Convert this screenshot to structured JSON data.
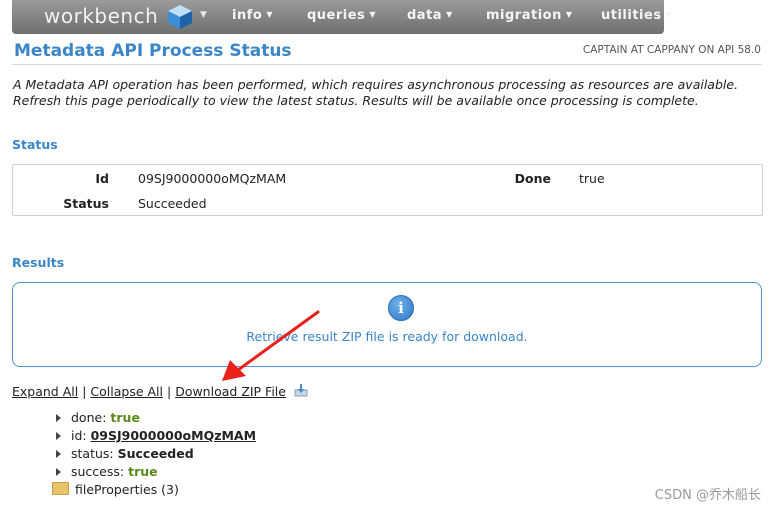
{
  "nav": {
    "logo": "workbench",
    "items": [
      {
        "label": "info"
      },
      {
        "label": "queries"
      },
      {
        "label": "data"
      },
      {
        "label": "migration"
      },
      {
        "label": "utilities"
      }
    ]
  },
  "header": {
    "title": "Metadata API Process Status",
    "user_info": "CAPTAIN AT CAPPANY ON API 58.0"
  },
  "intro": "A Metadata API operation has been performed, which requires asynchronous processing as resources are available. Refresh this page periodically to view the latest status. Results will be available once processing is complete.",
  "status": {
    "heading": "Status",
    "id_label": "Id",
    "id_value": "09SJ9000000oMQzMAM",
    "done_label": "Done",
    "done_value": "true",
    "status_label": "Status",
    "status_value": "Succeeded"
  },
  "results": {
    "heading": "Results",
    "info_message": "Retrieve result ZIP file is ready for download."
  },
  "links": {
    "expand_all": "Expand All",
    "collapse_all": "Collapse All",
    "download_zip": "Download ZIP File",
    "sep": "|"
  },
  "tree": {
    "done_key": "done:",
    "done_val": "true",
    "id_key": "id:",
    "id_val": "09SJ9000000oMQzMAM",
    "status_key": "status:",
    "status_val": "Succeeded",
    "success_key": "success:",
    "success_val": "true",
    "file_properties": "fileProperties (3)"
  },
  "watermark": "CSDN @乔木船长",
  "colors": {
    "accent_blue": "#3a86c8",
    "true_green": "#5b8a1c",
    "annotation_red": "#e8221b",
    "nav_gray": "#7f7f7f"
  }
}
